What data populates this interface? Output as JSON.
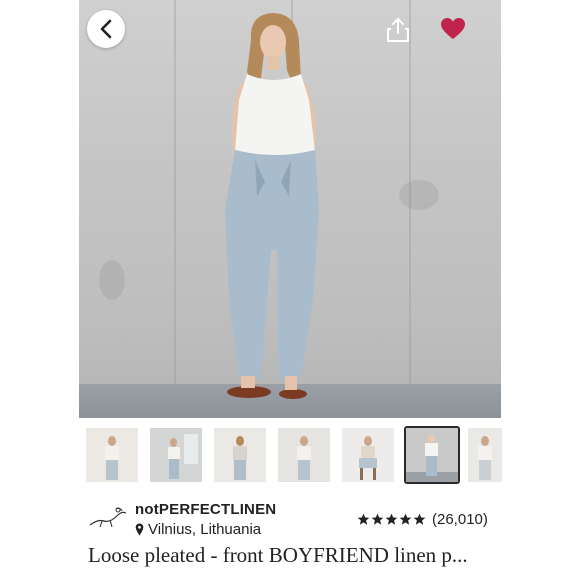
{
  "hero": {
    "back_icon": "chevron-left-icon",
    "share_icon": "share-upload-icon",
    "favorite_icon": "heart-icon",
    "favorite_active": true,
    "favorite_color": "#c0234b"
  },
  "thumbnails": {
    "count": 7,
    "selected_index": 5,
    "items": [
      {
        "label": ""
      },
      {
        "label": ""
      },
      {
        "label": ""
      },
      {
        "label": ""
      },
      {
        "label": ""
      },
      {
        "label": ""
      },
      {
        "label": ""
      }
    ]
  },
  "seller": {
    "name": "notPERFECTLINEN",
    "location": "Vilnius, Lithuania",
    "location_icon": "map-pin-icon"
  },
  "rating": {
    "stars": 5,
    "count_text": "(26,010)"
  },
  "listing": {
    "title": "Loose pleated - front BOYFRIEND linen p..."
  }
}
